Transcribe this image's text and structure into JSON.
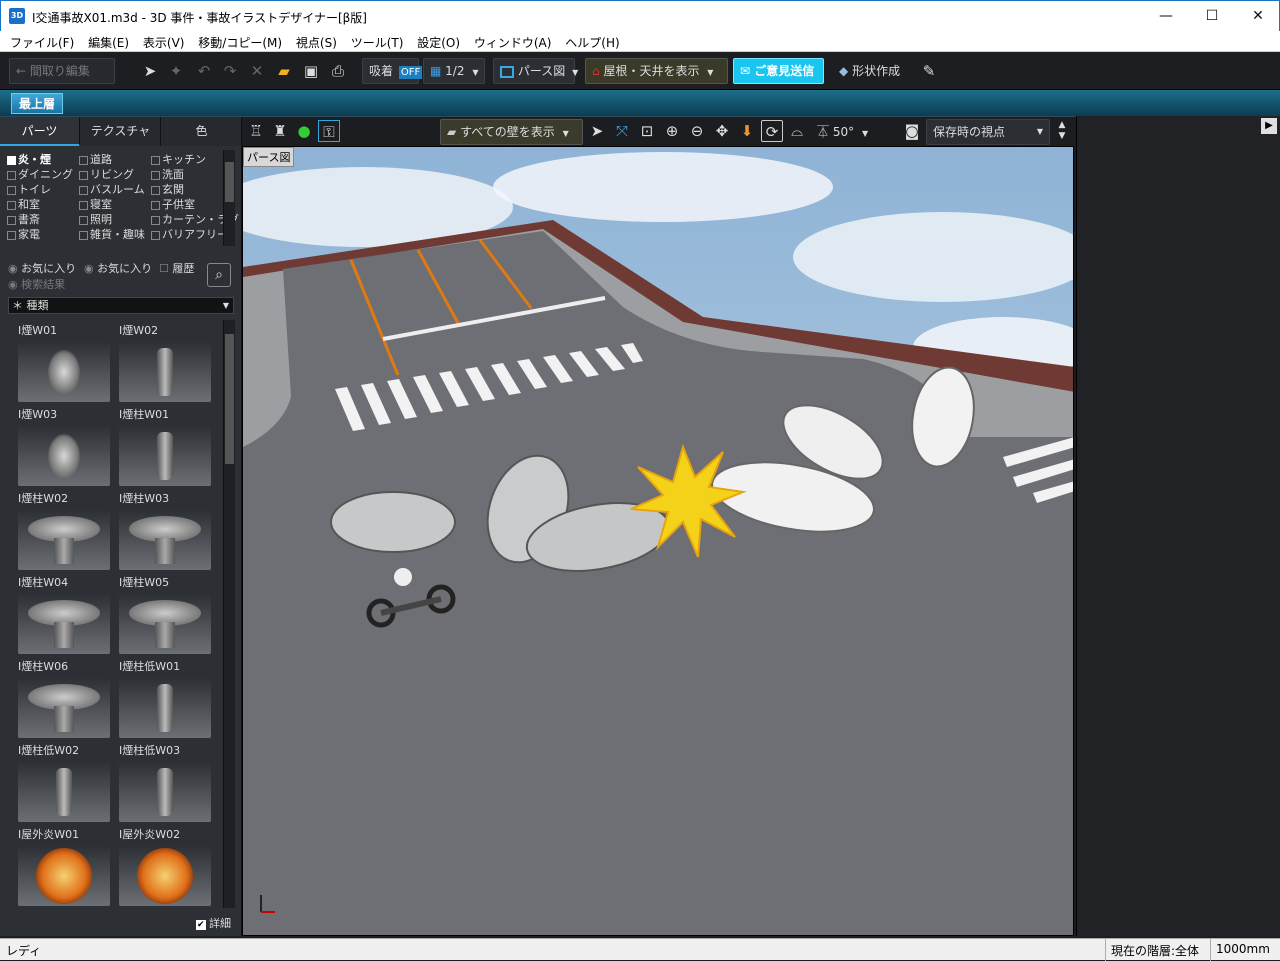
{
  "window": {
    "title": "I交通事故X01.m3d - 3D 事件・事故イラストデザイナー[β版]",
    "app_icon": "3D",
    "minimize": "—",
    "maximize": "☐",
    "close": "✕"
  },
  "menu": [
    "ファイル(F)",
    "編集(E)",
    "表示(V)",
    "移動/コピー(M)",
    "視点(S)",
    "ツール(T)",
    "設定(O)",
    "ウィンドウ(A)",
    "ヘルプ(H)"
  ],
  "toolbar": {
    "back_label": "← 間取り編集",
    "snap_label": "吸着",
    "snap_state": "OFF",
    "grid_label": "1/2",
    "view_label": "パース図",
    "roof_label": "屋根・天井を表示",
    "feedback_label": "ご意見送信",
    "shape_label": "形状作成"
  },
  "layer": {
    "label": "最上層"
  },
  "left_tabs": [
    "パーツ",
    "テクスチャ",
    "色"
  ],
  "categories": [
    [
      "炎・煙",
      "道路",
      "キッチン"
    ],
    [
      "ダイニング",
      "リビング",
      "洗面"
    ],
    [
      "トイレ",
      "バスルーム",
      "玄関"
    ],
    [
      "和室",
      "寝室",
      "子供室"
    ],
    [
      "書斎",
      "照明",
      "カーテン・ラグ"
    ],
    [
      "家電",
      "雑貨・趣味",
      "バリアフリー"
    ]
  ],
  "filters": {
    "fav1": "お気に入り",
    "fav2": "お気に入り",
    "history": "履歴",
    "search_results": "検索結果",
    "type_select": "＊ 種類"
  },
  "parts": [
    {
      "name": "I煙W01",
      "kind": "smoke"
    },
    {
      "name": "I煙W02",
      "kind": "pillar"
    },
    {
      "name": "I煙W03",
      "kind": "smoke"
    },
    {
      "name": "I煙柱W01",
      "kind": "pillar"
    },
    {
      "name": "I煙柱W02",
      "kind": "bowl"
    },
    {
      "name": "I煙柱W03",
      "kind": "bowl"
    },
    {
      "name": "I煙柱W04",
      "kind": "bowl"
    },
    {
      "name": "I煙柱W05",
      "kind": "bowl"
    },
    {
      "name": "I煙柱W06",
      "kind": "bowl"
    },
    {
      "name": "I煙柱低W01",
      "kind": "pillar"
    },
    {
      "name": "I煙柱低W02",
      "kind": "pillar"
    },
    {
      "name": "I煙柱低W03",
      "kind": "pillar"
    },
    {
      "name": "I屋外炎W01",
      "kind": "fire"
    },
    {
      "name": "I屋外炎W02",
      "kind": "fire"
    }
  ],
  "detail_label": "詳細",
  "view_toolbar": {
    "walls_label": "すべての壁を表示",
    "fov_label": "50°",
    "viewpoint_label": "保存時の視点"
  },
  "viewport": {
    "label": "パース図"
  },
  "status": {
    "left": "レディ",
    "floor": "現在の階層:全体",
    "unit": "1000mm"
  },
  "colors": {
    "accent": "#2fa7df",
    "feedback": "#1fd0f5",
    "road": "#6f7075",
    "sidewalk": "#6e3a33"
  }
}
